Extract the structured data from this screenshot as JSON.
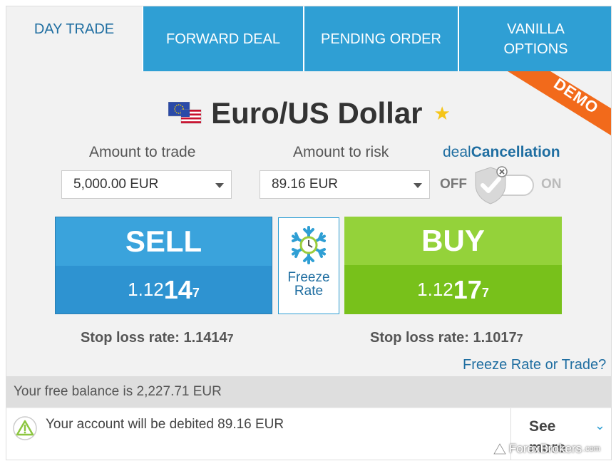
{
  "tabs": [
    {
      "label": "DAY TRADE",
      "active": true
    },
    {
      "label": "FORWARD DEAL",
      "active": false
    },
    {
      "label": "PENDING ORDER",
      "active": false
    },
    {
      "label": "VANILLA OPTIONS",
      "active": false
    }
  ],
  "ribbon": {
    "text": "DEMO",
    "color": "#f26a1b"
  },
  "instrument": {
    "title": "Euro/US Dollar",
    "flag_icon": "eu-us-flag-icon",
    "favorite_icon": "star-icon"
  },
  "amount_to_trade": {
    "label": "Amount to trade",
    "value": "5,000.00 EUR"
  },
  "amount_to_risk": {
    "label": "Amount to risk",
    "value": "89.16 EUR"
  },
  "deal_cancellation": {
    "label_prefix": "deal",
    "label_bold": "Cancellation",
    "off_label": "OFF",
    "on_label": "ON",
    "state": "off"
  },
  "sell": {
    "label": "SELL",
    "rate_prefix": "1.12",
    "rate_big": "14",
    "rate_small": "7",
    "stop_loss_label": "Stop loss rate: 1.1414",
    "stop_loss_small": "7"
  },
  "buy": {
    "label": "BUY",
    "rate_prefix": "1.12",
    "rate_big": "17",
    "rate_small": "7",
    "stop_loss_label": "Stop loss rate: 1.1017",
    "stop_loss_small": "7"
  },
  "freeze": {
    "line1": "Freeze",
    "line2": "Rate",
    "link": "Freeze Rate or Trade?"
  },
  "balance": {
    "text": "Your free balance is 2,227.71 EUR"
  },
  "debit": {
    "text": "Your account will be debited 89.16 EUR",
    "see_label": "See",
    "see_more": "more"
  },
  "watermark": {
    "text": "ForexBrokers",
    "suffix": ".com"
  },
  "colors": {
    "tab_blue": "#2f9fd4",
    "sell_blue": "#3aa3dc",
    "buy_green": "#94d23a",
    "link_blue": "#1f6ea1",
    "star": "#f5c518"
  }
}
